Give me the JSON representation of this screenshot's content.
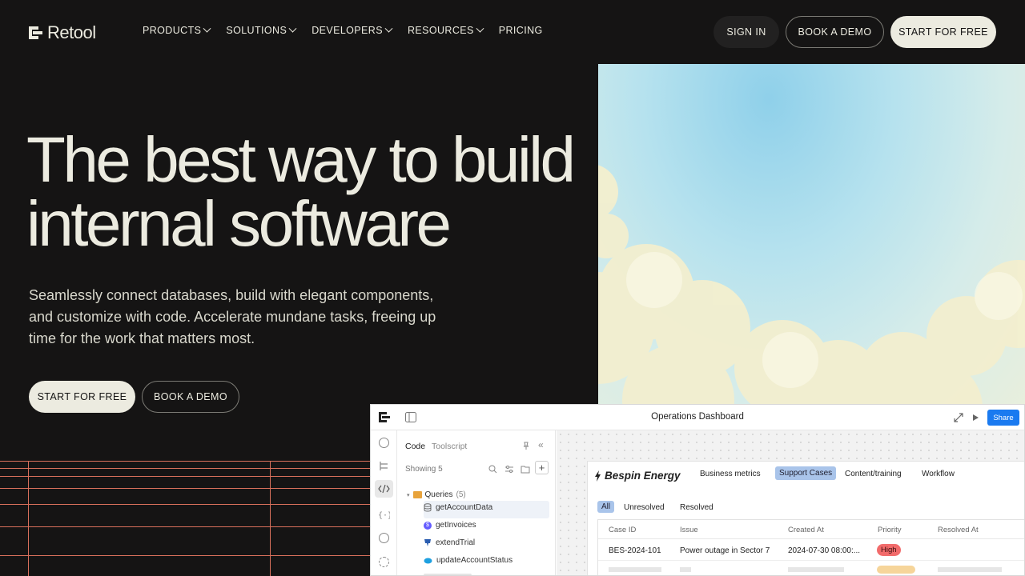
{
  "header": {
    "logo_text": "Retool",
    "nav": [
      "PRODUCTS",
      "SOLUTIONS",
      "DEVELOPERS",
      "RESOURCES",
      "PRICING"
    ],
    "sign_in": "SIGN IN",
    "book_demo": "BOOK A DEMO",
    "start_free": "START FOR FREE"
  },
  "hero": {
    "headline_line1": "The best way to build",
    "headline_line2": "internal software",
    "subtext": "Seamlessly connect databases, build with elegant components, and customize with code. Accelerate mundane tasks, freeing up time for the work that matters most.",
    "cta_start": "START FOR FREE",
    "cta_demo": "BOOK A DEMO"
  },
  "app": {
    "title": "Operations Dashboard",
    "share": "Share",
    "code_tab": "Code",
    "toolscript_tab": "Toolscript",
    "showing": "Showing 5",
    "queries_label": "Queries",
    "queries_count": "(5)",
    "queries": [
      "getAccountData",
      "getInvoices",
      "extendTrial",
      "updateAccountStatus"
    ],
    "brand": "Bespin Energy",
    "dash_tabs": [
      "Business metrics",
      "Support Cases",
      "Content/training",
      "Workflow"
    ],
    "filters": [
      "All",
      "Unresolved",
      "Resolved"
    ],
    "columns": [
      "Case ID",
      "Issue",
      "Created At",
      "Priority",
      "Resolved At"
    ],
    "row": {
      "case_id": "BES-2024-101",
      "issue": "Power outage in Sector 7",
      "created": "2024-07-30 08:00:...",
      "priority": "High"
    }
  },
  "colors": {
    "background": "#151414",
    "cream": "#ecebe0",
    "grid_line": "#d9705c",
    "share_blue": "#1a7af0",
    "priority_high": "#f26b6b"
  }
}
